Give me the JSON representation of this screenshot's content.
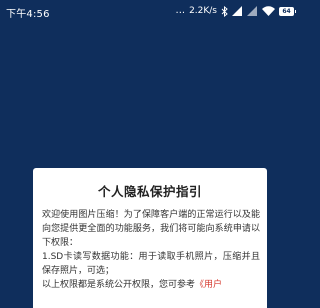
{
  "status_bar": {
    "time": "下午4:56",
    "dots": "...",
    "net_speed": "2.2K/s",
    "battery_level": "64",
    "icons": [
      "bluetooth-icon",
      "signal-icon",
      "signal-icon",
      "wifi-icon",
      "battery-icon"
    ]
  },
  "dialog": {
    "title": "个人隐私保护指引",
    "paragraph_1": "欢迎使用图片压缩！为了保障客户端的正常运行以及能向您提供更全面的功能服务，我们将可能向系统申请以下权限：",
    "paragraph_2": "1.SD卡读写数据功能：用于读取手机照片，压缩并且保存照片，可选；",
    "paragraph_3_prefix": "以上权限都是系统公开权限，您可参考",
    "paragraph_3_link": "《用户"
  },
  "colors": {
    "background": "#0f2e5c",
    "dialog_bg": "#ffffff",
    "link": "#d63a2f"
  }
}
